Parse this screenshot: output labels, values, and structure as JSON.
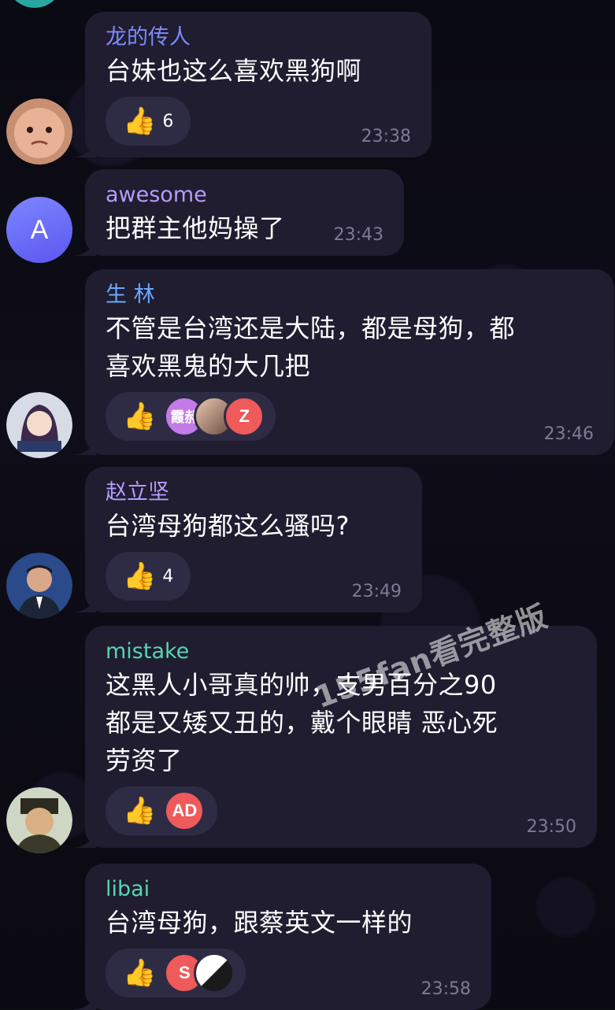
{
  "messages": [
    {
      "sender": "龙的传人",
      "sender_color": "#7d8bff",
      "text": "台妹也这么喜欢黑狗啊",
      "reaction": {
        "emoji": "👍",
        "count": "6"
      },
      "time": "23:38"
    },
    {
      "sender": "awesome",
      "sender_color": "#b59cff",
      "avatar_letter": "A",
      "text": "把群主他妈操了",
      "time": "23:43"
    },
    {
      "sender": "生 林",
      "sender_color": "#6aa8ff",
      "text_lines": [
        "不管是台湾还是大陆，都是母狗，都",
        "喜欢黑鬼的大几把"
      ],
      "reaction": {
        "emoji": "👍",
        "avatars": [
          "霞郝",
          "",
          "Z"
        ]
      },
      "time": "23:46"
    },
    {
      "sender": "赵立坚",
      "sender_color": "#b59cff",
      "text": "台湾母狗都这么骚吗?",
      "reaction": {
        "emoji": "👍",
        "count": "4"
      },
      "time": "23:49"
    },
    {
      "sender": "mistake",
      "sender_color": "#56d6b0",
      "text_lines": [
        "这黑人小哥真的帅，支男百分之90",
        "都是又矮又丑的，戴个眼睛 恶心死",
        "劳资了"
      ],
      "reaction": {
        "emoji": "👍",
        "avatars": [
          "AD"
        ]
      },
      "time": "23:50"
    },
    {
      "sender": "libai",
      "sender_color": "#56d6b0",
      "text": "台湾母狗，跟蔡英文一样的",
      "reaction": {
        "emoji": "👍",
        "avatars": [
          "S",
          ""
        ]
      },
      "time": "23:58"
    }
  ],
  "watermark": "155fan看完整版"
}
